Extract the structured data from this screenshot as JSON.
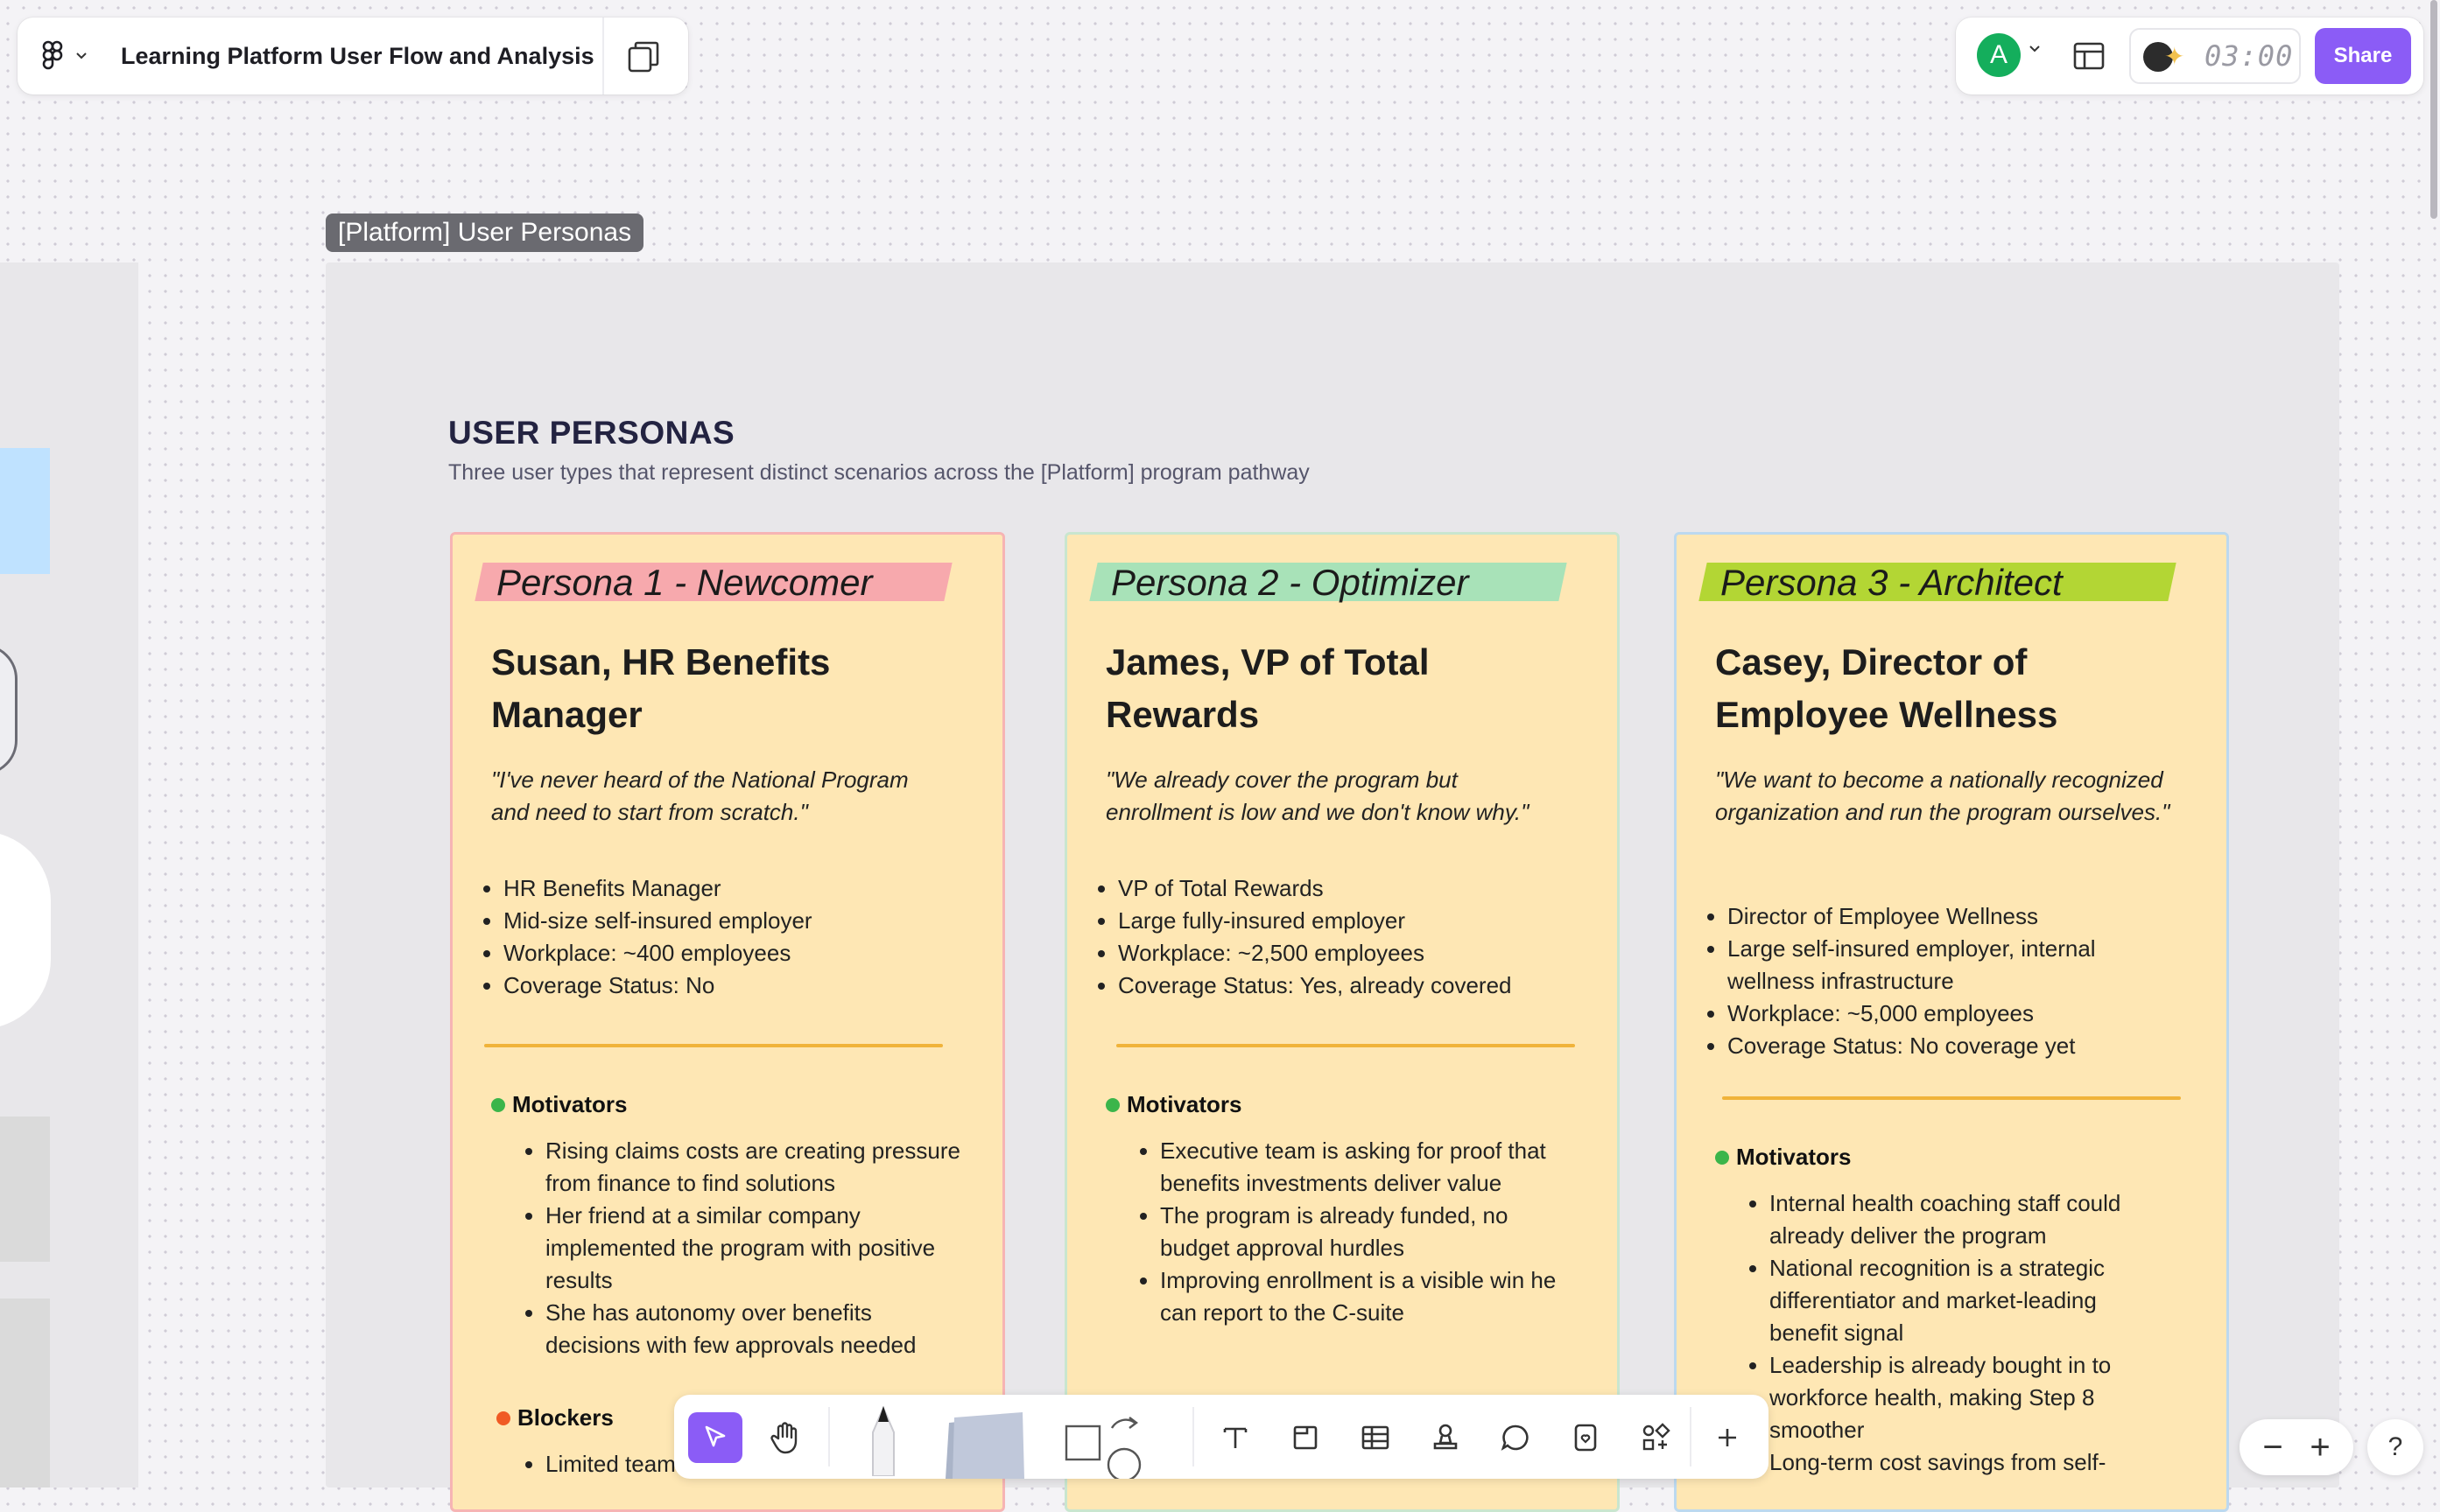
{
  "file": {
    "title": "Learning Platform User Flow and Analysis"
  },
  "header_right": {
    "avatar_initial": "A",
    "timer": "03:00",
    "share_label": "Share"
  },
  "frame_label": "[Platform] User Personas",
  "section": {
    "title": "USER PERSONAS",
    "subtitle": "Three user types that represent distinct scenarios across the [Platform] program pathway"
  },
  "colors": {
    "accent": "#8b5cf6",
    "card_bg": "#fee7b4",
    "motivator_dot": "#3bb54a",
    "blocker_dot": "#f05a24"
  },
  "personas": [
    {
      "tag": "Persona 1 - Newcomer",
      "tag_color": "#f7a9ad",
      "border_color": "#f6b4b4",
      "name": "Susan, HR Benefits Manager",
      "quote": "\"I've never heard of the National Program and need to start from scratch.\"",
      "facts": [
        "HR Benefits Manager",
        "Mid-size self-insured employer",
        "Workplace: ~400 employees",
        "Coverage Status: No"
      ],
      "motivators_label": "Motivators",
      "motivators": [
        "Rising claims costs are creating pressure from finance to find solutions",
        "Her friend at a similar company implemented the program with positive results",
        "She has autonomy over benefits decisions with few approvals needed"
      ],
      "blockers_label": "Blockers",
      "blockers": [
        "Limited team"
      ]
    },
    {
      "tag": "Persona 2 - Optimizer",
      "tag_color": "#a8e2b8",
      "border_color": "#c9e6cf",
      "name": "James, VP of Total Rewards",
      "quote": "\"We already cover the program but enrollment is low and we don't know why.\"",
      "facts": [
        "VP of Total Rewards",
        "Large fully-insured employer",
        "Workplace: ~2,500 employees",
        "Coverage Status: Yes, already covered"
      ],
      "motivators_label": "Motivators",
      "motivators": [
        "Executive team is asking for proof that benefits investments deliver value",
        "The program is already funded, no budget approval hurdles",
        "Improving enrollment is a visible win he can report to the C-suite"
      ]
    },
    {
      "tag": "Persona 3 - Architect",
      "tag_color": "#b3d634",
      "border_color": "#bcd9ef",
      "name": "Casey, Director of Employee Wellness",
      "quote": "\"We want to become a nationally recognized organization and run the program ourselves.\"",
      "facts": [
        "Director of Employee Wellness",
        "Large self-insured employer, internal wellness infrastructure",
        "Workplace: ~5,000 employees",
        "Coverage Status: No coverage yet"
      ],
      "motivators_label": "Motivators",
      "motivators": [
        "Internal health coaching staff could already deliver the program",
        "National recognition is a strategic differentiator and market-leading benefit signal",
        "Leadership is already bought in to workforce health, making Step 8 smoother",
        "Long-term cost savings from self-"
      ]
    }
  ],
  "toolbar": {
    "tools": [
      "move-tool",
      "hand-tool",
      "pen-tool",
      "sticky-tool",
      "shape-tool",
      "connector-tool",
      "text-tool",
      "section-tool",
      "table-tool",
      "stamp-tool",
      "comment-tool",
      "widget-tool",
      "apps-tool",
      "more-tool"
    ]
  },
  "zoom": {
    "minus": "−",
    "plus": "+",
    "help": "?"
  }
}
